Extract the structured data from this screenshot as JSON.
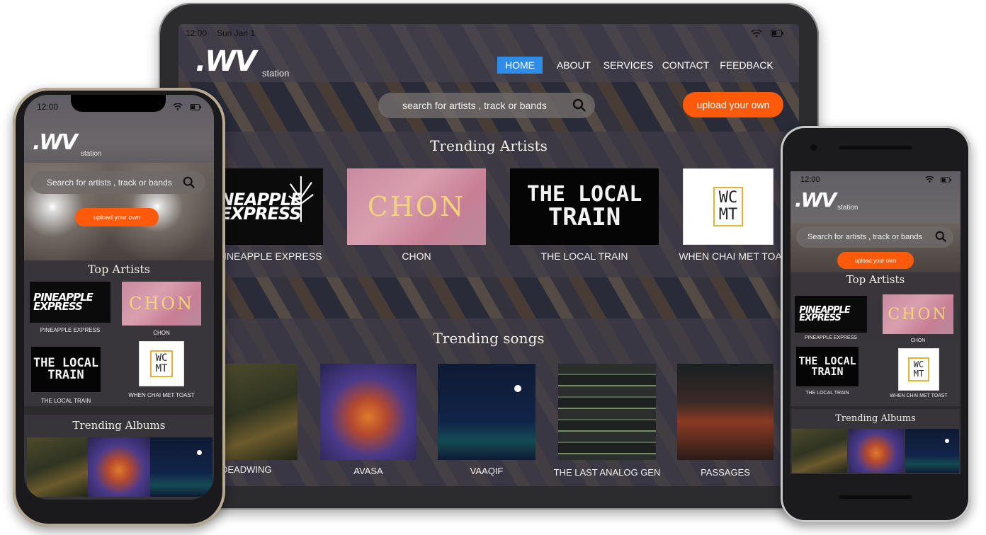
{
  "logo": {
    "mark": ".WV",
    "sub": "station"
  },
  "tablet": {
    "status": {
      "time": "12:00",
      "date": "Sun Jan 1"
    },
    "nav": [
      "HOME",
      "ABOUT",
      "SERVICES",
      "CONTACT",
      "FEEDBACK"
    ],
    "search_placeholder": "search for artists , track or bands",
    "upload_label": "upload your own",
    "trending_artists_title": "Trending Artists",
    "artists": [
      "INEAPPLE EXPRESS",
      "CHON",
      "THE LOCAL TRAIN",
      "WHEN CHAI MET TOAST"
    ],
    "trending_songs_title": "Trending songs",
    "songs": [
      "DEADWING",
      "AVASA",
      "VAAQIF",
      "THE LAST ANALOG GEN",
      "PASSAGES"
    ]
  },
  "artwork": {
    "pine_line1": "NEAPPLE",
    "pine_line2": "EXPRESS",
    "pine_full1": "PINEAPPLE",
    "pine_full2": "EXPRESS",
    "chon": "CHON",
    "local_line1": "THE LOCAL",
    "local_line2": "TRAIN",
    "wcmt_line1": "WC",
    "wcmt_line2": "MT"
  },
  "phone_left": {
    "time": "12:00",
    "search_placeholder": "Search for artists , track or bands",
    "upload_label": "upload your own",
    "top_artists_title": "Top Artists",
    "artists": [
      "PINEAPPLE EXPRESS",
      "CHON",
      "THE LOCAL TRAIN",
      "WHEN CHAI MET TOAST"
    ],
    "albums_title": "Trending Albums"
  },
  "phone_right": {
    "time": "12:00",
    "search_placeholder": "Search for artists , track or bands",
    "upload_label": "upload your own",
    "top_artists_title": "Top Artists",
    "artists": [
      "PINEAPPLE EXPRESS",
      "CHON",
      "THE LOCAL TRAIN",
      "WHEN CHAI MET TOAST"
    ],
    "albums_title": "Trending Albums"
  },
  "colors": {
    "accent_orange": "#ff5a0a",
    "nav_active": "#2f8dea"
  },
  "icons": [
    "search-icon",
    "wifi-icon",
    "battery-icon"
  ]
}
